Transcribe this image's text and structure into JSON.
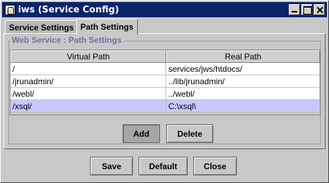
{
  "window": {
    "title": "iws (Service Config)",
    "controls": {
      "minimize_icon": "minimize-icon",
      "maximize_icon": "maximize-icon",
      "close_icon": "close-icon"
    }
  },
  "tabs": [
    {
      "label": "Service Settings",
      "active": false
    },
    {
      "label": "Path Settings",
      "active": true
    }
  ],
  "group": {
    "title": "Web Service : Path Settings"
  },
  "table": {
    "columns": [
      "Virtual Path",
      "Real Path"
    ],
    "rows": [
      {
        "virtual": "/",
        "real": "services/jws/htdocs/",
        "selected": false
      },
      {
        "virtual": "/jrunadmin/",
        "real": "../lib/jrunadmin/",
        "selected": false
      },
      {
        "virtual": "/webl/",
        "real": "../webl/",
        "selected": false
      },
      {
        "virtual": "/xsql/",
        "real": "C:\\xsql\\",
        "selected": true
      }
    ]
  },
  "buttons": {
    "add": "Add",
    "delete": "Delete"
  },
  "footer": {
    "save": "Save",
    "default": "Default",
    "close": "Close"
  },
  "colors": {
    "titlebar": "#0a246a",
    "selection": "#c8c8ff",
    "group_title": "#7070a0"
  }
}
